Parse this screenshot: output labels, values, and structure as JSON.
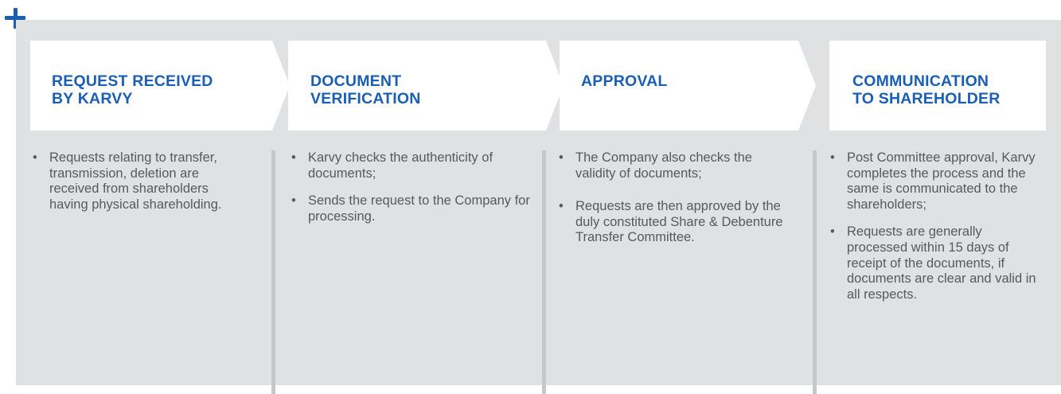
{
  "steps": [
    {
      "title": "REQUEST RECEIVED\nBY KARVY",
      "bullets": [
        "Requests relating to transfer, transmission, deletion  are received from shareholders having physical shareholding."
      ]
    },
    {
      "title": "DOCUMENT\nVERIFICATION",
      "bullets": [
        "Karvy checks the authenticity of documents;",
        "Sends the request to the Company for processing."
      ]
    },
    {
      "title": "APPROVAL",
      "bullets": [
        "The Company also checks the validity of documents;",
        "Requests are then approved by the duly constituted Share & Debenture Transfer Committee."
      ]
    },
    {
      "title": "COMMUNICATION\nTO SHAREHOLDER",
      "bullets": [
        "Post Committee approval, Karvy completes the process and the same is communicated to the shareholders;",
        "Requests are generally processed within 15 days of receipt of the documents, if documents are clear and valid in all respects."
      ]
    }
  ],
  "colors": {
    "accent": "#1a5fb4",
    "panel": "#e0e1e3",
    "header_box": "#ffffff",
    "text": "#58595b",
    "divider": "#c6c7c9"
  },
  "icons": {
    "corner": "plus-icon"
  }
}
